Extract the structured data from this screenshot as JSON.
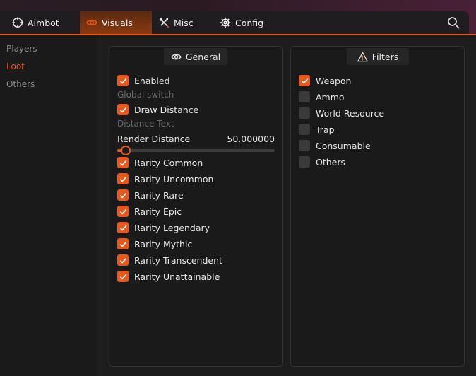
{
  "tabs": [
    {
      "label": "Aimbot",
      "icon": "crosshair-icon",
      "active": false
    },
    {
      "label": "Visuals",
      "icon": "eye-icon",
      "active": true
    },
    {
      "label": "Misc",
      "icon": "tools-icon",
      "active": false
    },
    {
      "label": "Config",
      "icon": "gear-icon",
      "active": false
    }
  ],
  "sidebar": {
    "items": [
      {
        "label": "Players",
        "active": false
      },
      {
        "label": "Loot",
        "active": true
      },
      {
        "label": "Others",
        "active": false
      }
    ]
  },
  "general": {
    "title": "General",
    "enabled_label": "Enabled",
    "enabled": true,
    "global_switch_text": "Global switch",
    "draw_distance_label": "Draw Distance",
    "draw_distance": true,
    "distance_text": "Distance Text",
    "render_distance_label": "Render Distance",
    "render_distance_value": "50.000000",
    "render_distance_fraction": 0.02,
    "rarities": [
      {
        "label": "Rarity Common",
        "checked": true
      },
      {
        "label": "Rarity Uncommon",
        "checked": true
      },
      {
        "label": "Rarity Rare",
        "checked": true
      },
      {
        "label": "Rarity Epic",
        "checked": true
      },
      {
        "label": "Rarity Legendary",
        "checked": true
      },
      {
        "label": "Rarity Mythic",
        "checked": true
      },
      {
        "label": "Rarity Transcendent",
        "checked": true
      },
      {
        "label": "Rarity Unattainable",
        "checked": true
      }
    ]
  },
  "filters": {
    "title": "Filters",
    "items": [
      {
        "label": "Weapon",
        "checked": true
      },
      {
        "label": "Ammo",
        "checked": false
      },
      {
        "label": "World Resource",
        "checked": false
      },
      {
        "label": "Trap",
        "checked": false
      },
      {
        "label": "Consumable",
        "checked": false
      },
      {
        "label": "Others",
        "checked": false
      }
    ]
  },
  "colors": {
    "accent": "#e8581c",
    "background": "#1a1a1a",
    "muted_text": "#6b6b6b"
  }
}
